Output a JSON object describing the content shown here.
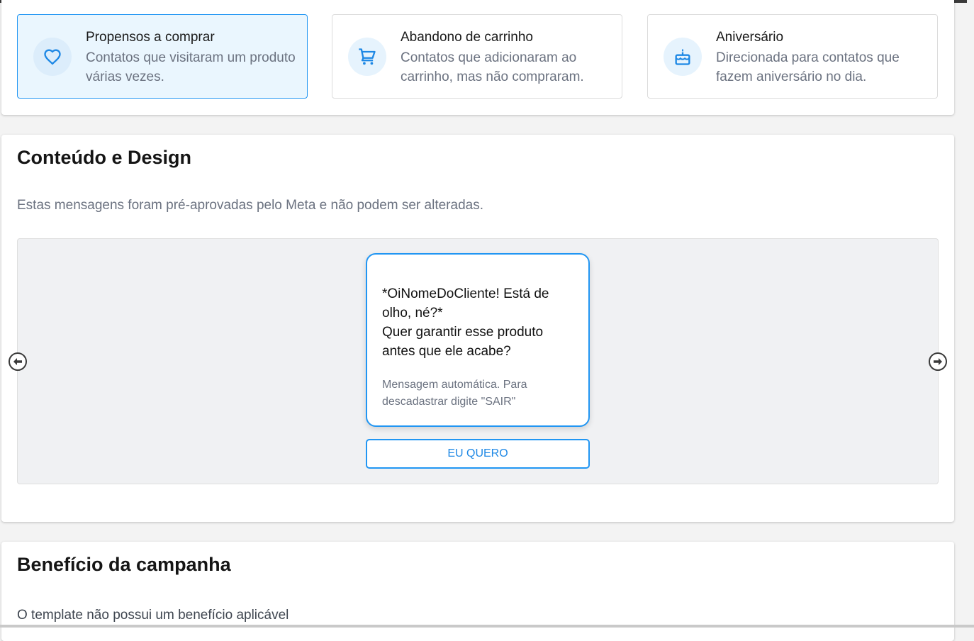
{
  "audience": {
    "options": [
      {
        "title": "Propensos a comprar",
        "description": "Contatos que visitaram um produto várias vezes.",
        "icon": "heart-icon",
        "selected": true
      },
      {
        "title": "Abandono de carrinho",
        "description": "Contatos que adicionaram ao carrinho, mas não compraram.",
        "icon": "cart-icon",
        "selected": false
      },
      {
        "title": "Aniversário",
        "description": "Direcionada para contatos que fazem aniversário no dia.",
        "icon": "cake-icon",
        "selected": false
      }
    ]
  },
  "content": {
    "title": "Conteúdo e Design",
    "subtitle": "Estas mensagens foram pré-aprovadas pelo Meta e não podem ser alteradas.",
    "message": {
      "body": "*OiNomeDoCliente! Está de olho, né?*\nQuer garantir esse produto antes que ele acabe?",
      "footer": "Mensagem automática. Para descadastrar digite \"SAIR\"",
      "button_label": "EU QUERO"
    },
    "prev_icon": "arrow-left-circle-icon",
    "next_icon": "arrow-right-circle-icon"
  },
  "benefit": {
    "title": "Benefício da campanha",
    "subtitle": "O template não possui um benefício aplicável"
  },
  "colors": {
    "accent": "#2196f3",
    "selected_bg": "#eaf6fe",
    "muted_text": "#6b7280",
    "preview_bg": "#f0f1f3"
  }
}
